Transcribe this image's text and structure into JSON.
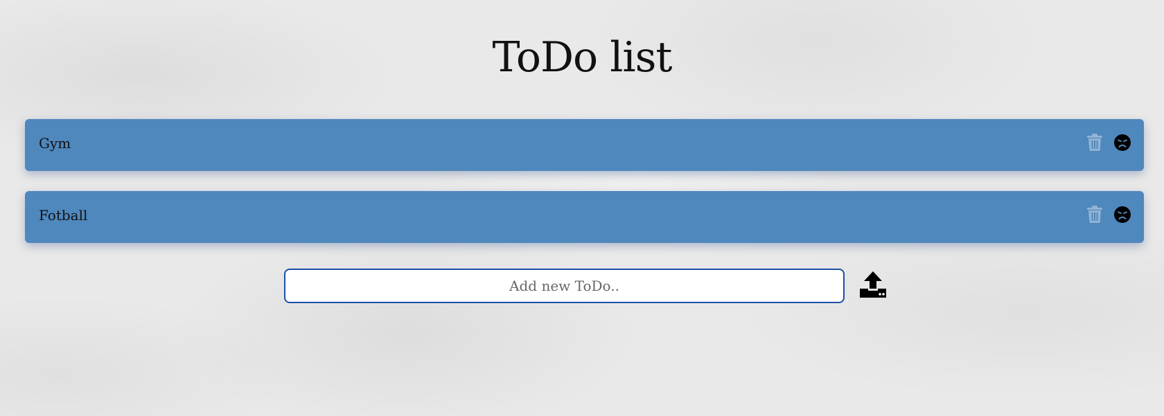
{
  "header": {
    "title": "ToDo list"
  },
  "todos": [
    {
      "text": "Gym",
      "delete_icon": "trash-icon",
      "status_icon": "sad-face-icon"
    },
    {
      "text": "Fotball",
      "delete_icon": "trash-icon",
      "status_icon": "sad-face-icon"
    }
  ],
  "add_form": {
    "placeholder": "Add new ToDo..",
    "value": "",
    "submit_icon": "upload-icon"
  },
  "colors": {
    "item_background": "#4f88bd",
    "input_border": "#1a4fa6",
    "page_background": "#e9e9e9"
  }
}
